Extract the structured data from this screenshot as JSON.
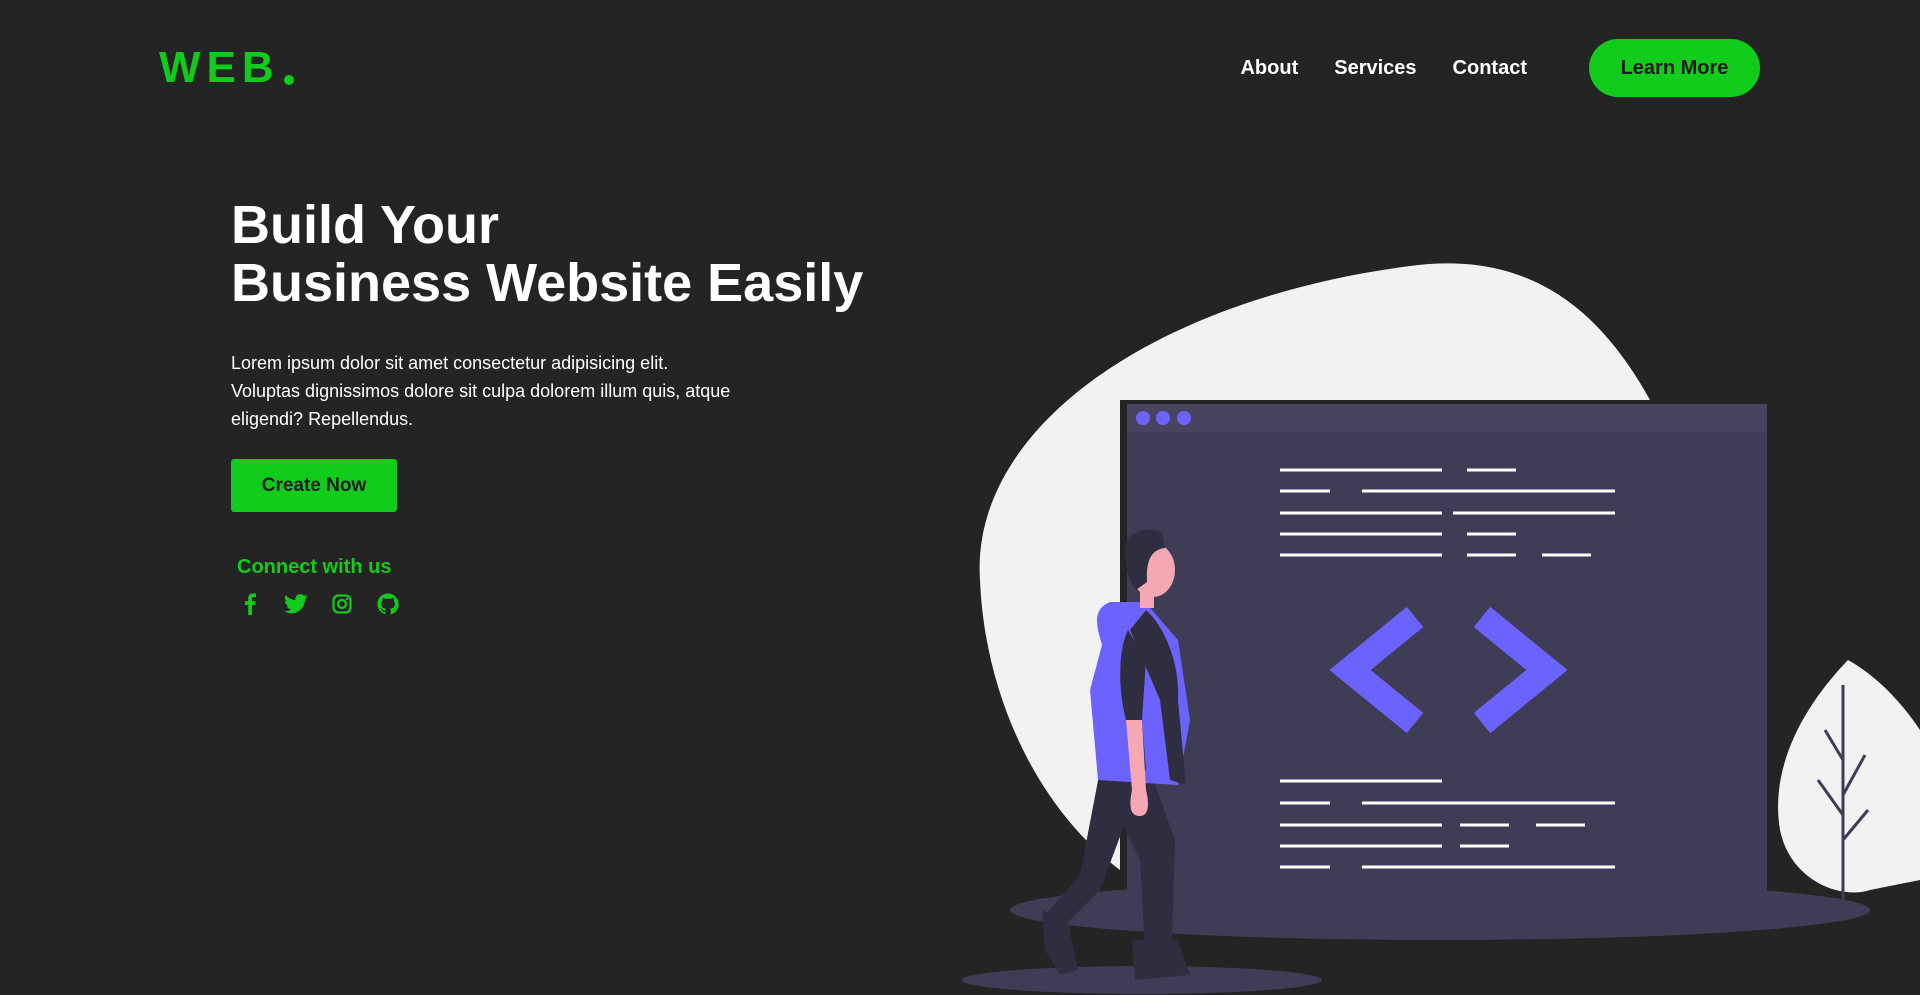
{
  "brand": {
    "logo_text": "WEB",
    "accent_color": "#11cc1a",
    "background_color": "#242424"
  },
  "nav": {
    "links": [
      "About",
      "Services",
      "Contact"
    ],
    "cta_label": "Learn More"
  },
  "hero": {
    "title_line1": "Build Your",
    "title_line2": "Business Website Easily",
    "text_line1": "Lorem ipsum dolor sit amet consectetur adipisicing elit.",
    "text_line2": "Voluptas dignissimos dolore sit culpa dolorem illum quis, atque",
    "text_line3": "eligendi? Repellendus.",
    "button_label": "Create Now"
  },
  "connect": {
    "title": "Connect with us",
    "icons": [
      "facebook-icon",
      "twitter-icon",
      "instagram-icon",
      "github-icon"
    ]
  },
  "illustration": {
    "panel_color": "#3f3d56",
    "highlight_color": "#6c63ff",
    "blob_color": "#f2f2f2",
    "skin_color": "#f5a8b3"
  }
}
